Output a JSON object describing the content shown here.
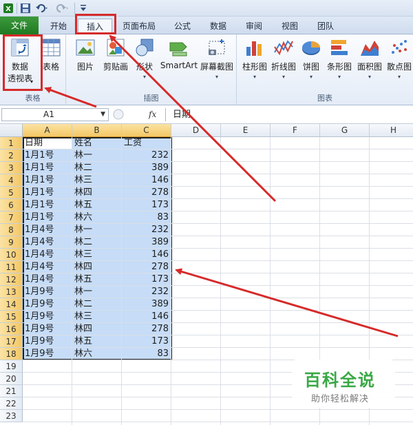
{
  "quick_access": {
    "save": "save-icon",
    "undo": "undo-icon",
    "redo": "redo-icon"
  },
  "tabs": [
    "文件",
    "开始",
    "插入",
    "页面布局",
    "公式",
    "数据",
    "审阅",
    "视图",
    "团队"
  ],
  "active_tab": "插入",
  "ribbon": {
    "groups": [
      {
        "label": "表格",
        "buttons": [
          {
            "line1": "数据",
            "line2": "透视表"
          },
          {
            "line1": "表格"
          }
        ]
      },
      {
        "label": "插图",
        "buttons": [
          {
            "line1": "图片"
          },
          {
            "line1": "剪贴画"
          },
          {
            "line1": "形状"
          },
          {
            "line1": "SmartArt"
          },
          {
            "line1": "屏幕截图"
          }
        ]
      },
      {
        "label": "图表",
        "buttons": [
          {
            "line1": "柱形图"
          },
          {
            "line1": "折线图"
          },
          {
            "line1": "饼图"
          },
          {
            "line1": "条形图"
          },
          {
            "line1": "面积图"
          },
          {
            "line1": "散点图"
          }
        ]
      }
    ]
  },
  "formula_bar": {
    "name_box": "A1",
    "fx": "fx",
    "content": "日期"
  },
  "columns": [
    "A",
    "B",
    "C",
    "D",
    "E",
    "F",
    "G",
    "H"
  ],
  "rows": [
    "1",
    "2",
    "3",
    "4",
    "5",
    "6",
    "7",
    "8",
    "9",
    "10",
    "11",
    "12",
    "13",
    "14",
    "15",
    "16",
    "17",
    "18",
    "19",
    "20",
    "21",
    "22",
    "23"
  ],
  "table": {
    "header": [
      "日期",
      "姓名",
      "工资"
    ],
    "rows": [
      [
        "1月1号",
        "林一",
        "232"
      ],
      [
        "1月1号",
        "林二",
        "389"
      ],
      [
        "1月1号",
        "林三",
        "146"
      ],
      [
        "1月1号",
        "林四",
        "278"
      ],
      [
        "1月1号",
        "林五",
        "173"
      ],
      [
        "1月1号",
        "林六",
        "83"
      ],
      [
        "1月4号",
        "林一",
        "232"
      ],
      [
        "1月4号",
        "林二",
        "389"
      ],
      [
        "1月4号",
        "林三",
        "146"
      ],
      [
        "1月4号",
        "林四",
        "278"
      ],
      [
        "1月4号",
        "林五",
        "173"
      ],
      [
        "1月9号",
        "林一",
        "232"
      ],
      [
        "1月9号",
        "林二",
        "389"
      ],
      [
        "1月9号",
        "林三",
        "146"
      ],
      [
        "1月9号",
        "林四",
        "278"
      ],
      [
        "1月9号",
        "林五",
        "173"
      ],
      [
        "1月9号",
        "林六",
        "83"
      ]
    ]
  },
  "watermark": {
    "title": "百科全说",
    "subtitle": "助你轻松解决"
  },
  "colors": {
    "accent_red": "#d62a2a",
    "selection": "#c6dcf7",
    "file_tab": "#2a8a2e"
  }
}
